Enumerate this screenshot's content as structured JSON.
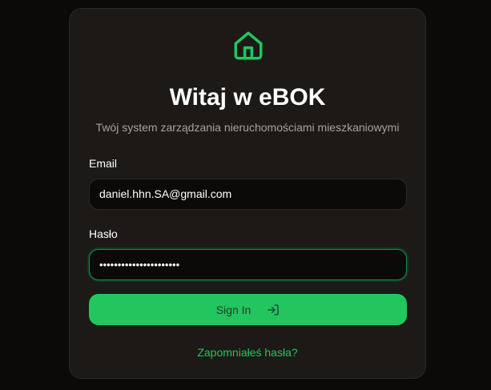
{
  "app": {
    "title": "Witaj w eBOK",
    "subtitle": "Twój system zarządzania nieruchomościami mieszkaniowymi",
    "logo_icon": "home-icon"
  },
  "form": {
    "email_label": "Email",
    "email_value": "daniel.hhn.SA@gmail.com",
    "password_label": "Hasło",
    "password_value": "••••••••••••••••••••••",
    "submit_label": "Sign In",
    "submit_icon": "sign-in-icon",
    "forgot_label": "Zapomniałeś hasła?"
  },
  "colors": {
    "accent": "#22c55e",
    "background": "#0b0a09",
    "card": "#1c1917"
  }
}
